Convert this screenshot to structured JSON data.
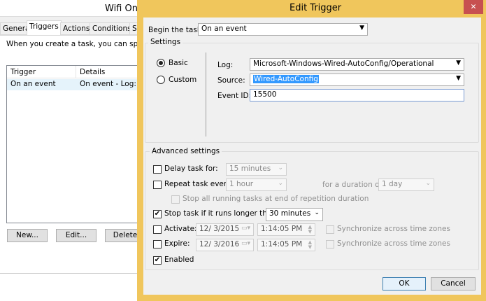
{
  "background_window": {
    "title": "Wifi On",
    "tabs": [
      "General",
      "Triggers",
      "Actions",
      "Conditions",
      "S"
    ],
    "active_tab": "Triggers",
    "description": "When you create a task, you can specify the",
    "columns": [
      "Trigger",
      "Details"
    ],
    "rows": [
      {
        "trigger": "On an event",
        "details": "On event - Log: Mi"
      }
    ],
    "buttons": {
      "new": "New...",
      "edit": "Edit...",
      "delete": "Delete"
    }
  },
  "dialog": {
    "title": "Edit Trigger",
    "close": "✕",
    "begin_label": "Begin the task:",
    "begin_value": "On an event",
    "settings": {
      "title": "Settings",
      "basic": "Basic",
      "custom": "Custom",
      "log_label": "Log:",
      "log_value": "Microsoft-Windows-Wired-AutoConfig/Operational",
      "source_label": "Source:",
      "source_value": "Wired-AutoConfig",
      "event_id_label": "Event ID:",
      "event_id_value": "15500"
    },
    "advanced": {
      "title": "Advanced settings",
      "delay_label": "Delay task for:",
      "delay_value": "15 minutes",
      "repeat_label": "Repeat task every:",
      "repeat_value": "1 hour",
      "duration_label": "for a duration of:",
      "duration_value": "1 day",
      "stop_all_label": "Stop all running tasks at end of repetition duration",
      "stop_label": "Stop task if it runs longer than:",
      "stop_value": "30 minutes",
      "activate_label": "Activate:",
      "activate_date": "12/  3/2015",
      "activate_time": "1:14:05 PM",
      "expire_label": "Expire:",
      "expire_date": "12/  3/2016",
      "expire_time": "1:14:05 PM",
      "sync_label": "Synchronize across time zones",
      "enabled_label": "Enabled",
      "check": "✔"
    },
    "ok": "OK",
    "cancel": "Cancel"
  },
  "colors": {
    "frame": "#f0c65c",
    "close": "#c75050",
    "selection": "#3399ff"
  }
}
